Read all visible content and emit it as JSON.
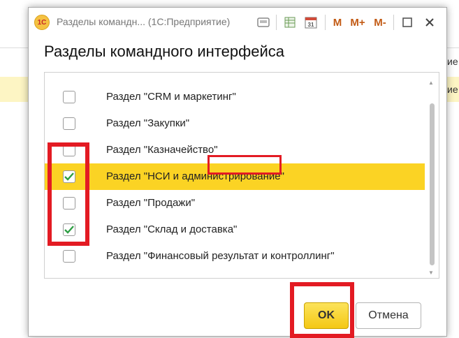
{
  "background": {
    "fragment_1": "ие",
    "fragment_2": "ие"
  },
  "titlebar": {
    "logo": "1C",
    "title": "Разделы командн... (1С:Предприятие)",
    "icons": [
      "save-icon",
      "table-icon",
      "calendar-icon"
    ],
    "memory_m": "M",
    "memory_mplus": "M+",
    "memory_mminus": "M-"
  },
  "dialog": {
    "heading": "Разделы командного интерфейса"
  },
  "sections": [
    {
      "label": "Раздел \"CRM и маркетинг\"",
      "checked": false,
      "selected": false
    },
    {
      "label": "Раздел \"Закупки\"",
      "checked": false,
      "selected": false
    },
    {
      "label": "Раздел \"Казначейство\"",
      "checked": false,
      "selected": false
    },
    {
      "label": "Раздел \"НСИ и администрирование\"",
      "checked": true,
      "selected": true
    },
    {
      "label": "Раздел \"Продажи\"",
      "checked": false,
      "selected": false
    },
    {
      "label": "Раздел \"Склад и доставка\"",
      "checked": true,
      "selected": false
    },
    {
      "label": "Раздел \"Финансовый результат и контроллинг\"",
      "checked": false,
      "selected": false
    }
  ],
  "buttons": {
    "ok": "OK",
    "cancel": "Отмена"
  },
  "colors": {
    "selection": "#fbd324",
    "check": "#2e9e44",
    "annotation": "#e31b23",
    "ok_button": "#f4c814"
  }
}
